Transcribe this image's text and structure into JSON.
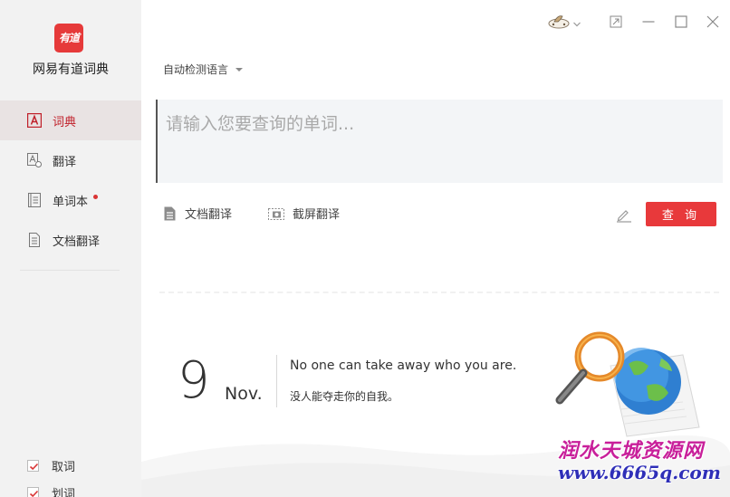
{
  "app": {
    "logo_text": "有道",
    "name": "网易有道词典"
  },
  "sidebar": {
    "items": [
      {
        "label": "词典",
        "icon": "dictionary-icon",
        "active": true
      },
      {
        "label": "翻译",
        "icon": "translate-icon",
        "active": false
      },
      {
        "label": "单词本",
        "icon": "wordbook-icon",
        "active": false,
        "badge": "red-dot"
      },
      {
        "label": "文档翻译",
        "icon": "document-icon",
        "active": false
      }
    ],
    "options": [
      {
        "label": "取词",
        "checked": true
      },
      {
        "label": "划词",
        "checked": true
      }
    ]
  },
  "toolbar": {
    "language_select": "自动检测语言",
    "window_icons": [
      "skin-icon",
      "chevron-down-icon",
      "mini-mode-icon",
      "minimize-icon",
      "maximize-icon",
      "close-icon"
    ]
  },
  "search": {
    "placeholder": "请输入您要查询的单词...",
    "value": "",
    "button_label": "查 询"
  },
  "tools": {
    "doc_translate": "文档翻译",
    "screenshot_translate": "截屏翻译"
  },
  "daily": {
    "day": "9",
    "month": "Nov.",
    "quote_en": "No one can take away who you are.",
    "quote_cn": "没人能夺走你的自我。"
  },
  "watermark": {
    "line1": "润水天城资源网",
    "line2": "www.6665q.com"
  },
  "colors": {
    "accent": "#e8393b",
    "sidebar_bg": "#f2f2f2",
    "active_item_bg": "#e9e3e3",
    "active_text": "#c0202a",
    "input_bg": "#f3f5f7"
  }
}
